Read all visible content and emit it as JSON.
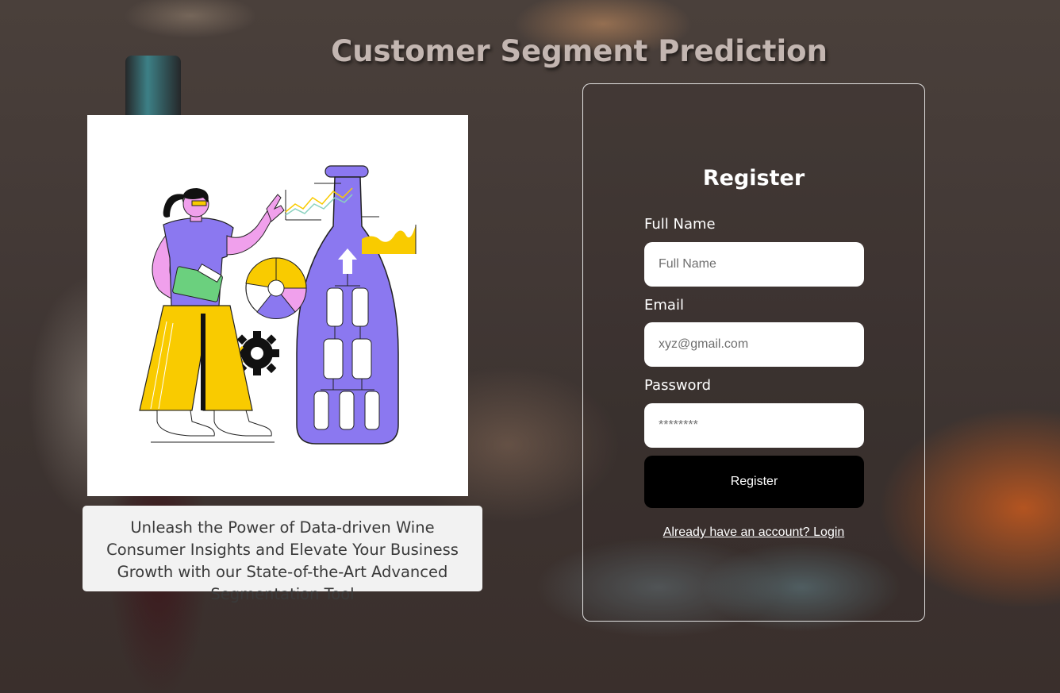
{
  "header": {
    "title": "Customer Segment Prediction"
  },
  "hero": {
    "illustration_icon": "data-analyst-wine-bottle-illustration",
    "caption": "Unleash the Power of Data-driven Wine Consumer Insights and Elevate Your Business Growth with our State-of-the-Art Advanced Segmentation Tool"
  },
  "form": {
    "title": "Register",
    "full_name": {
      "label": "Full Name",
      "placeholder": "Full Name",
      "value": ""
    },
    "email": {
      "label": "Email",
      "placeholder": "xyz@gmail.com",
      "value": ""
    },
    "password": {
      "label": "Password",
      "placeholder": "********",
      "value": ""
    },
    "submit_label": "Register",
    "login_link": "Already have an account? Login"
  },
  "colors": {
    "button": "#000000",
    "illustration_purple": "#8b78f0",
    "illustration_yellow": "#f9cb00",
    "illustration_pink": "#f0a0ec"
  }
}
